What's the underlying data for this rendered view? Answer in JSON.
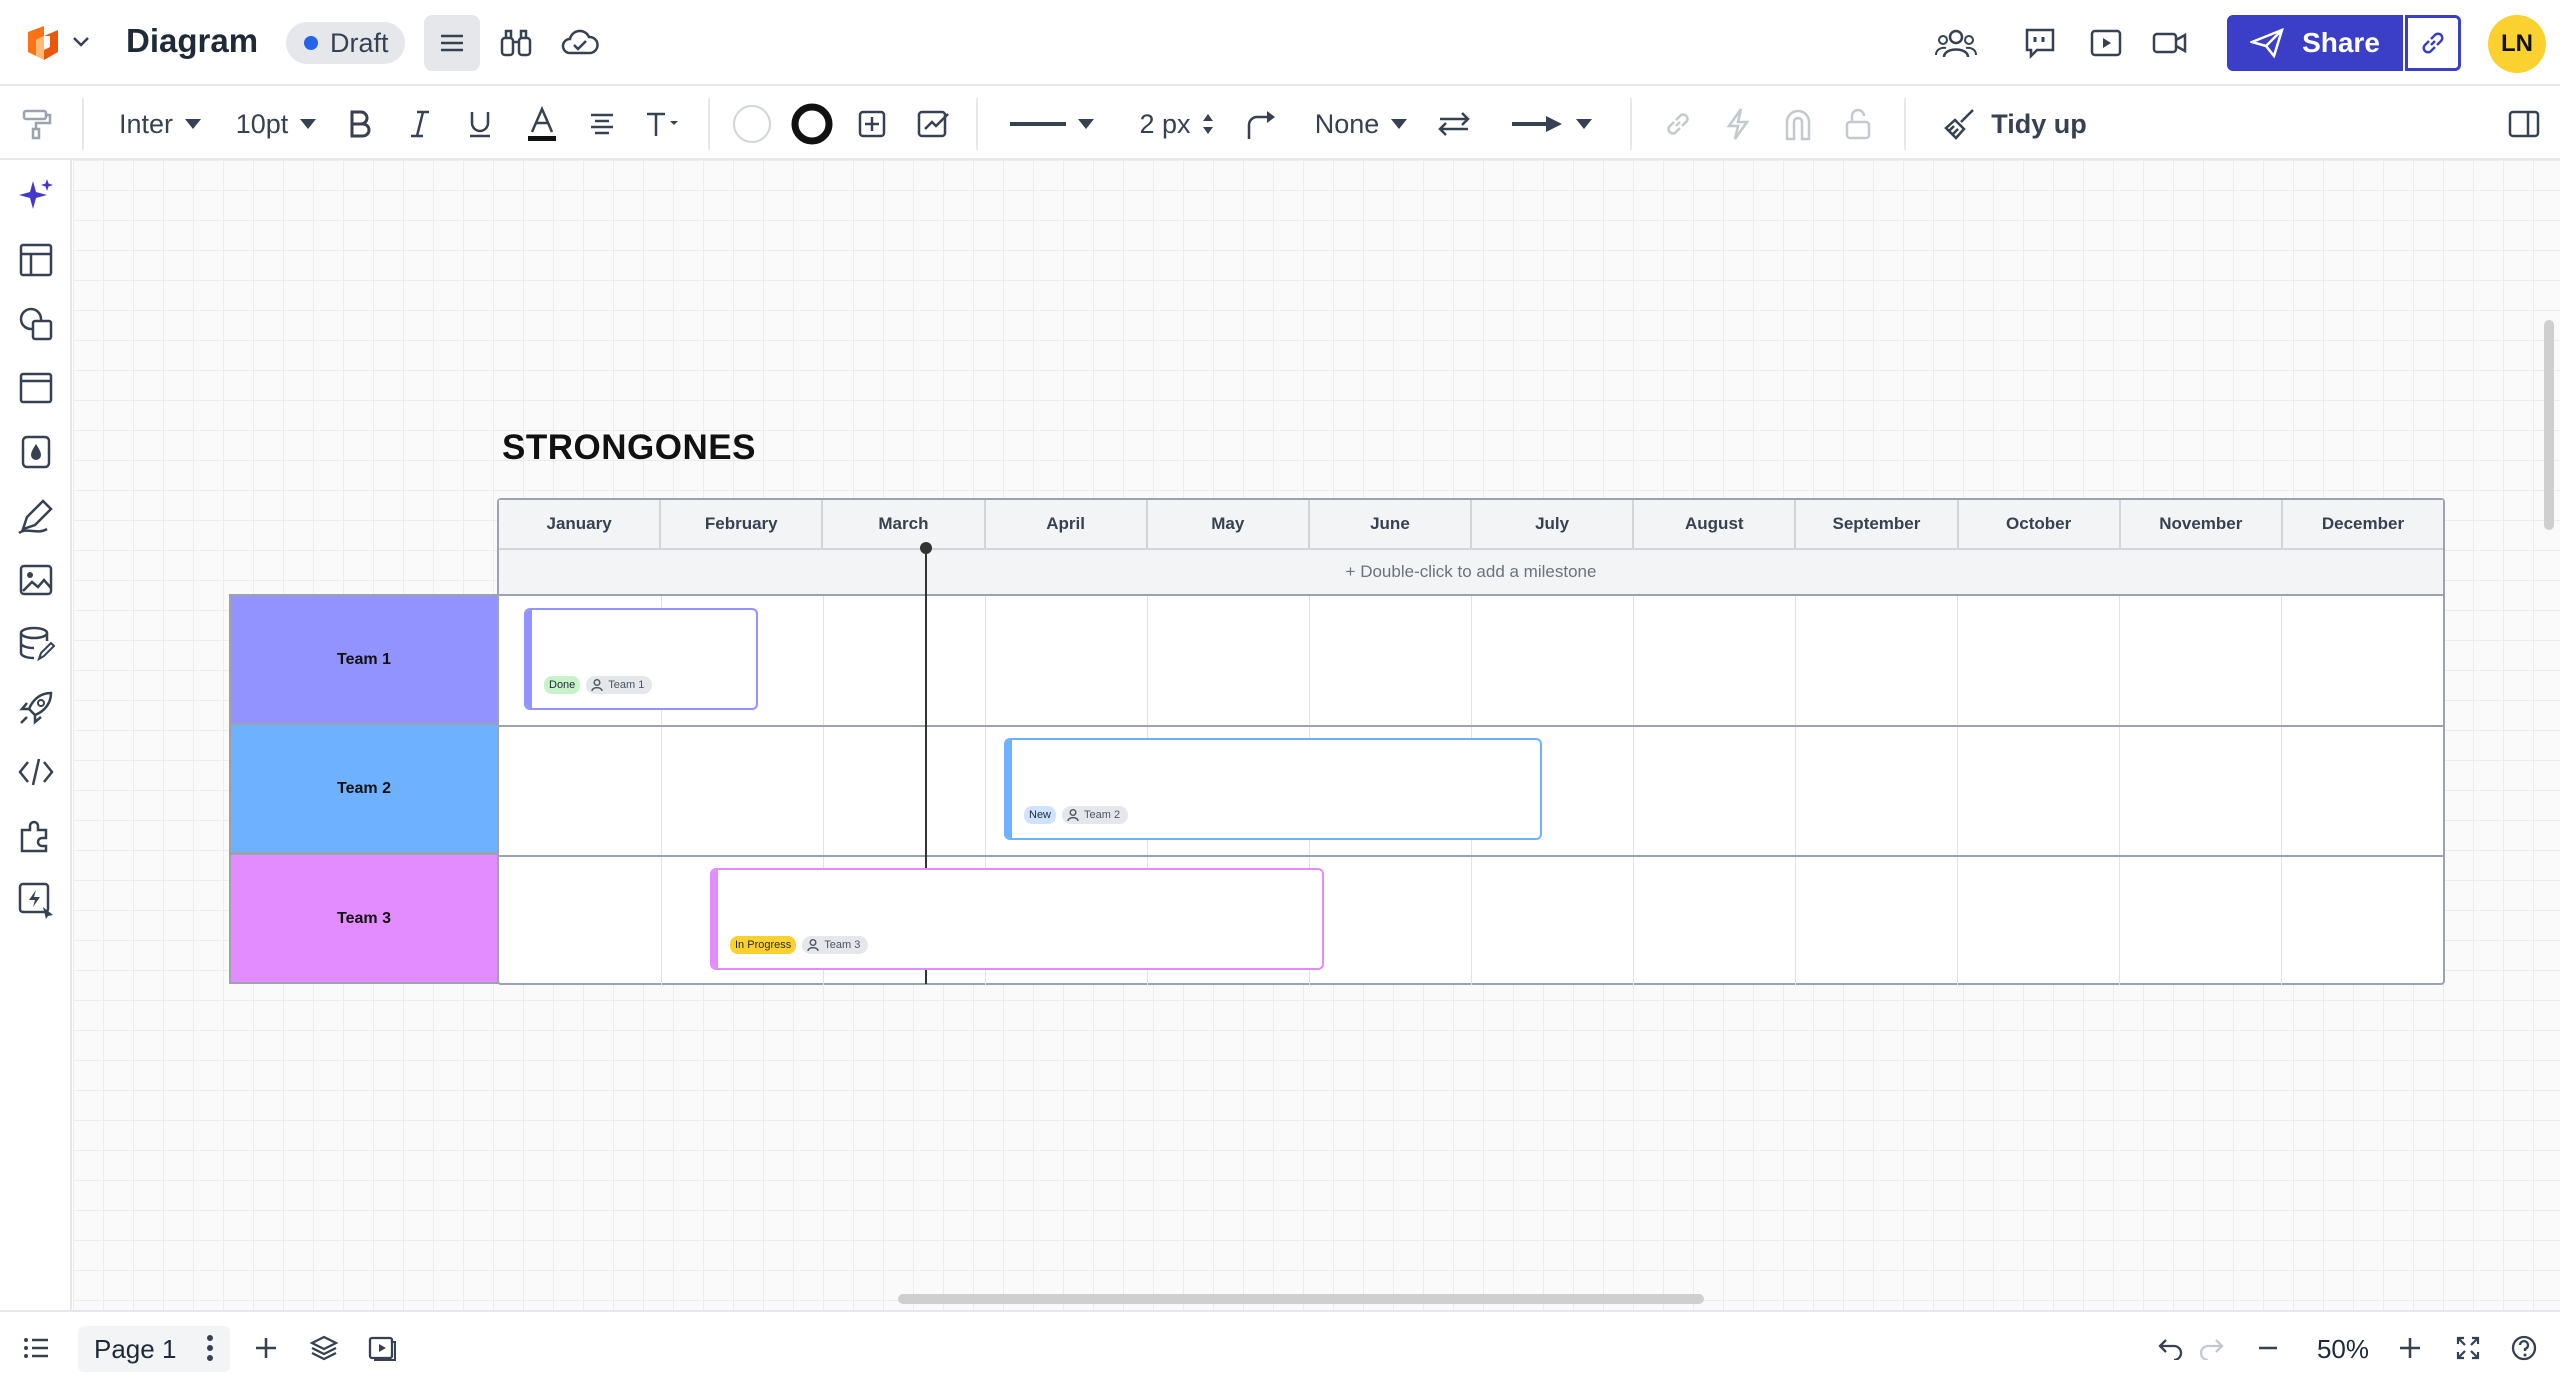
{
  "app": {
    "title": "Diagram",
    "status": "Draft",
    "share_label": "Share",
    "avatar_initials": "LN",
    "brand_color": "#3b3fc7"
  },
  "toolbar": {
    "font": "Inter",
    "font_size": "10pt",
    "line_width": "2 px",
    "endpoint": "None",
    "tidy_up_label": "Tidy up"
  },
  "diagram": {
    "title": "STRONGONES",
    "milestone_hint": "+ Double-click to add a milestone",
    "months": [
      "January",
      "February",
      "March",
      "April",
      "May",
      "June",
      "July",
      "August",
      "September",
      "October",
      "November",
      "December"
    ],
    "teams": [
      {
        "name": "Team 1",
        "color": "#9393ff"
      },
      {
        "name": "Team 2",
        "color": "#6eb2ff"
      },
      {
        "name": "Team 3",
        "color": "#e28cff"
      }
    ],
    "tasks": [
      {
        "status": "Done",
        "status_color": "#c8f2c8",
        "team": "Team 1",
        "border": "#9393ff"
      },
      {
        "status": "New",
        "status_color": "#cfe3ff",
        "team": "Team 2",
        "border": "#6eb2ff"
      },
      {
        "status": "In Progress",
        "status_color": "#fbd12f",
        "team": "Team 3",
        "border": "#e28cff"
      }
    ]
  },
  "bottom": {
    "page_name": "Page 1",
    "zoom": "50%"
  },
  "icons": {
    "top": [
      "collaborators-icon",
      "comment-icon",
      "present-icon",
      "video-call-icon"
    ],
    "rail": [
      "ai-sparkle-icon",
      "templates-icon",
      "shapes-icon",
      "frame-icon",
      "fill-icon",
      "draw-icon",
      "image-icon",
      "data-icon",
      "rocket-icon",
      "code-icon",
      "integrations-icon",
      "quick-action-icon"
    ]
  }
}
